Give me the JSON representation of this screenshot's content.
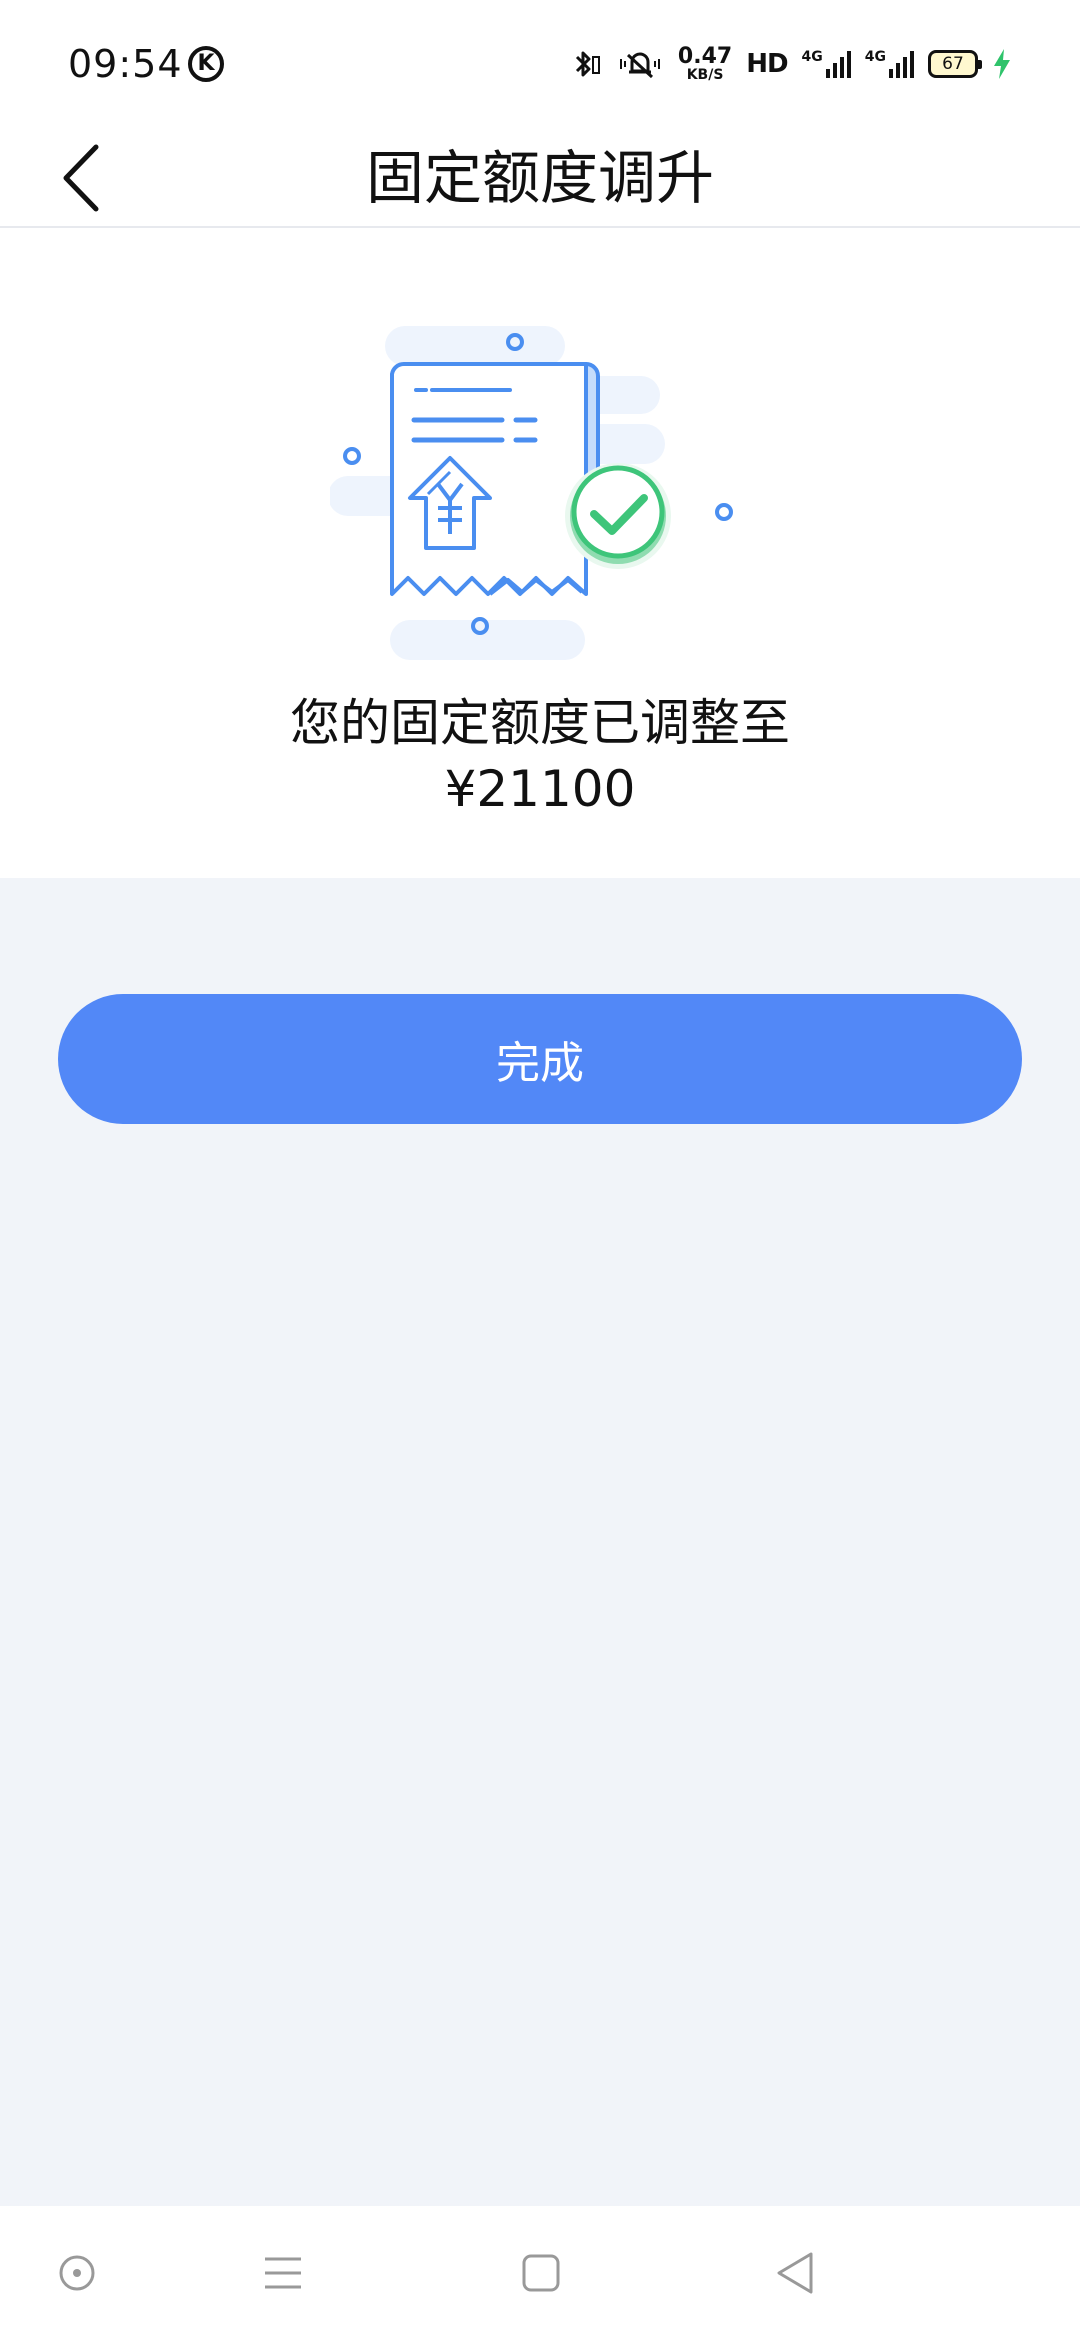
{
  "status_bar": {
    "time": "09:54",
    "k_badge": "K",
    "net_speed_value": "0.47",
    "net_speed_unit": "KB/S",
    "hd_label": "HD",
    "signal1_label": "4G",
    "signal2_label": "4G",
    "battery_level": "67",
    "icons": [
      "bluetooth-icon",
      "vibrate-icon",
      "signal-icon",
      "charging-icon"
    ]
  },
  "header": {
    "title": "固定额度调升",
    "back_icon": "chevron-left-icon"
  },
  "result": {
    "illustration": "receipt-with-check-illustration",
    "message": "您的固定额度已调整至",
    "amount": "¥21100"
  },
  "actions": {
    "done_label": "完成"
  },
  "system_nav": {
    "icons": [
      "circle-dot-icon",
      "menu-lines-icon",
      "square-icon",
      "triangle-back-icon"
    ]
  },
  "colors": {
    "accent": "#5288f7",
    "page_background": "#f1f4f9",
    "illustration_blue": "#4a8ef0",
    "check_green": "#3ec57a"
  }
}
